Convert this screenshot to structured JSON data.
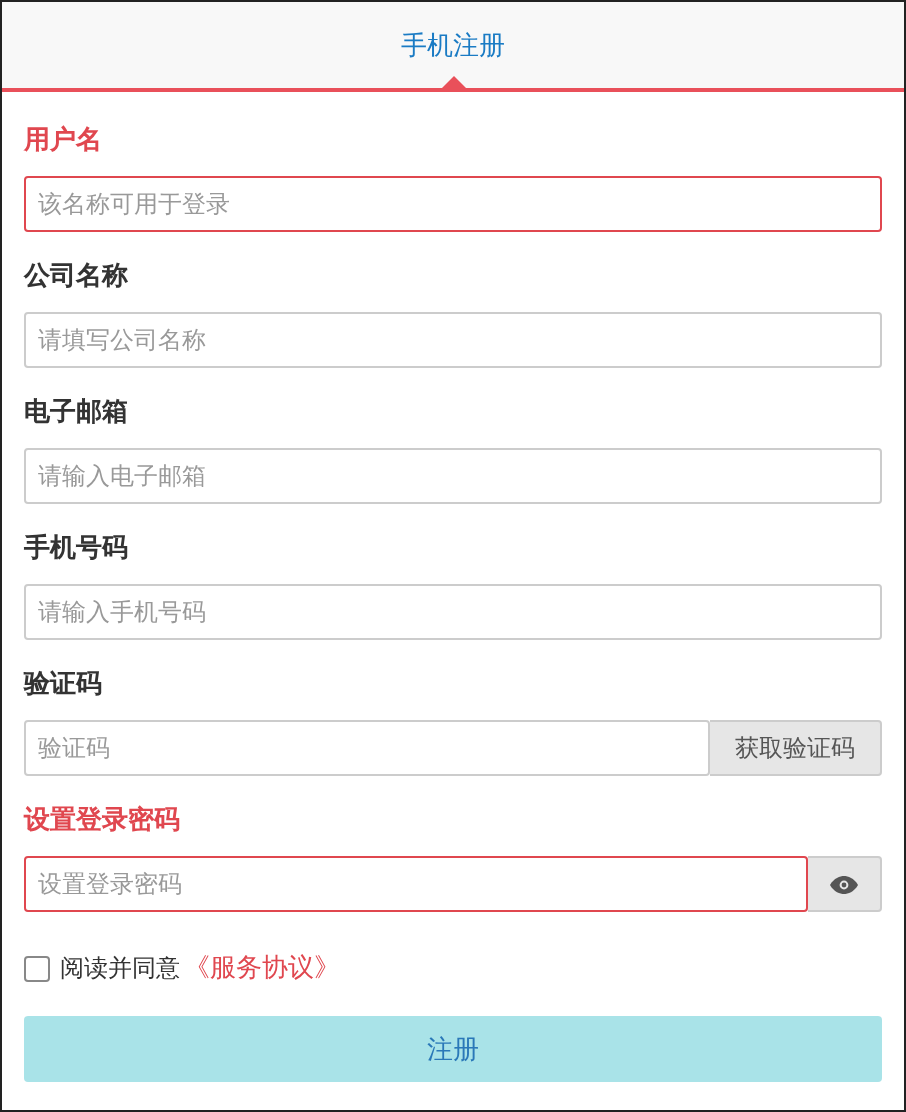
{
  "tab": {
    "label": "手机注册",
    "selected": true
  },
  "fields": [
    {
      "kind": "text",
      "label": "用户名",
      "placeholder": "该名称可用于登录",
      "error": true
    },
    {
      "kind": "text",
      "label": "公司名称",
      "placeholder": "请填写公司名称",
      "error": false
    },
    {
      "kind": "text",
      "label": "电子邮箱",
      "placeholder": "请输入电子邮箱",
      "error": false
    },
    {
      "kind": "text",
      "label": "手机号码",
      "placeholder": "请输入手机号码",
      "error": false
    },
    {
      "kind": "code",
      "label": "验证码",
      "placeholder": "验证码",
      "error": false,
      "button": "获取验证码"
    },
    {
      "kind": "password",
      "label": "设置登录密码",
      "placeholder": "设置登录密码",
      "error": true
    }
  ],
  "agreement": {
    "checked": false,
    "text": "阅读并同意",
    "link": "《服务协议》"
  },
  "submit": "注册"
}
